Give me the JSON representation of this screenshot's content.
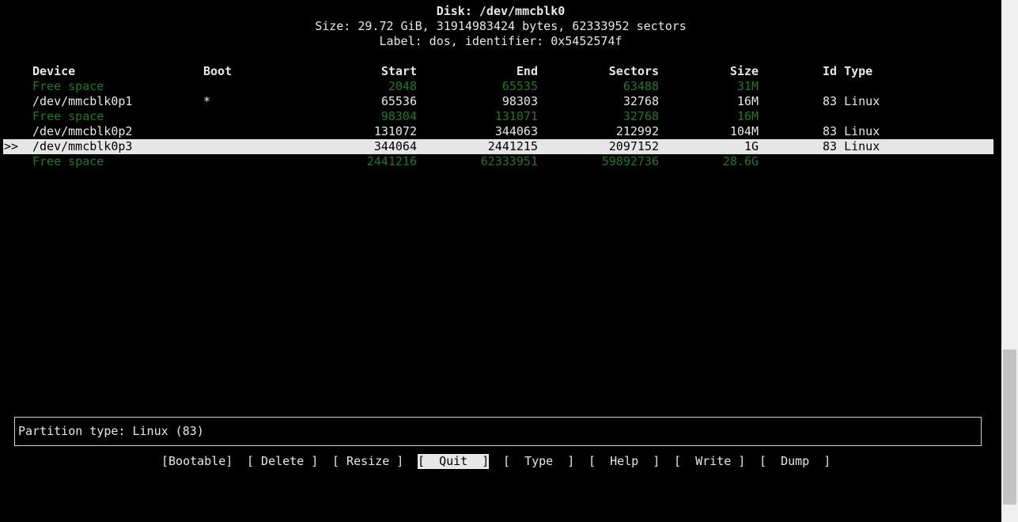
{
  "header": {
    "disk": "Disk: /dev/mmcblk0",
    "size": "Size: 29.72 GiB, 31914983424 bytes, 62333952 sectors",
    "label": "Label: dos, identifier: 0x5452574f"
  },
  "columns": {
    "device": "Device",
    "boot": "Boot",
    "start": "Start",
    "end": "End",
    "sectors": "Sectors",
    "size": "Size",
    "idtype": "Id Type"
  },
  "rows": [
    {
      "marker": "",
      "device": "Free space",
      "boot": "",
      "start": "2048",
      "end": "65535",
      "sectors": "63488",
      "size": "31M",
      "idtype": "",
      "kind": "free"
    },
    {
      "marker": "",
      "device": "/dev/mmcblk0p1",
      "boot": "*",
      "start": "65536",
      "end": "98303",
      "sectors": "32768",
      "size": "16M",
      "idtype": "83 Linux",
      "kind": "part"
    },
    {
      "marker": "",
      "device": "Free space",
      "boot": "",
      "start": "98304",
      "end": "131071",
      "sectors": "32768",
      "size": "16M",
      "idtype": "",
      "kind": "free"
    },
    {
      "marker": "",
      "device": "/dev/mmcblk0p2",
      "boot": "",
      "start": "131072",
      "end": "344063",
      "sectors": "212992",
      "size": "104M",
      "idtype": "83 Linux",
      "kind": "part"
    },
    {
      "marker": ">>",
      "device": "/dev/mmcblk0p3",
      "boot": "",
      "start": "344064",
      "end": "2441215",
      "sectors": "2097152",
      "size": "1G",
      "idtype": "83 Linux",
      "kind": "selected"
    },
    {
      "marker": "",
      "device": "Free space",
      "boot": "",
      "start": "2441216",
      "end": "62333951",
      "sectors": "59892736",
      "size": "28.6G",
      "idtype": "",
      "kind": "free"
    }
  ],
  "info": {
    "text": "Partition type: Linux (83)"
  },
  "menu": [
    {
      "label": "[Bootable]",
      "selected": false
    },
    {
      "label": "[ Delete ]",
      "selected": false
    },
    {
      "label": "[ Resize ]",
      "selected": false
    },
    {
      "label": "[  Quit  ]",
      "selected": true
    },
    {
      "label": "[  Type  ]",
      "selected": false
    },
    {
      "label": "[  Help  ]",
      "selected": false
    },
    {
      "label": "[  Write ]",
      "selected": false
    },
    {
      "label": "[  Dump  ]",
      "selected": false
    }
  ],
  "colors": {
    "background": "#000000",
    "text": "#e8e8e8",
    "free_space": "#1e7a1e",
    "selection_bg": "#e6e6e6",
    "selection_fg": "#000000"
  }
}
